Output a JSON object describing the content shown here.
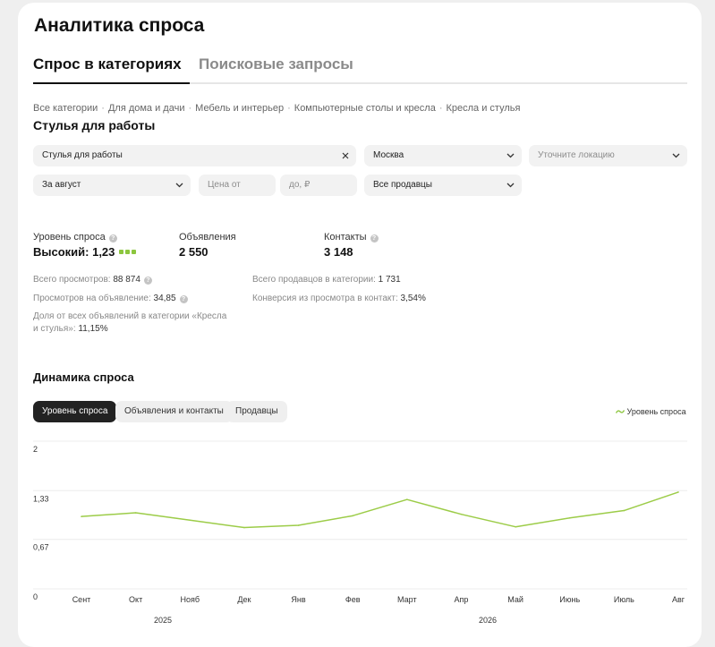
{
  "page_title": "Аналитика спроса",
  "tabs": [
    {
      "label": "Спрос в категориях",
      "active": true
    },
    {
      "label": "Поисковые запросы",
      "active": false
    }
  ],
  "breadcrumb": [
    "Все категории",
    "Для дома и дачи",
    "Мебель и интерьер",
    "Компьютерные столы и кресла",
    "Кресла и стулья"
  ],
  "category_title": "Стулья для работы",
  "filters": {
    "category_value": "Стулья для работы",
    "city_value": "Москва",
    "location_placeholder": "Уточните локацию",
    "period_value": "За август",
    "price_from_placeholder": "Цена от",
    "price_to_placeholder": "до, ₽",
    "sellers_value": "Все продавцы"
  },
  "metrics": {
    "demand_label": "Уровень спроса",
    "demand_value": "Высокий: 1,23",
    "ads_label": "Объявления",
    "ads_value": "2 550",
    "contacts_label": "Контакты",
    "contacts_value": "3 148"
  },
  "stats": {
    "views_label": "Всего просмотров:",
    "views_value": "88 874",
    "views_per_ad_label": "Просмотров на объявление:",
    "views_per_ad_value": "34,85",
    "share_label_line1": "Доля от всех объявлений в категории «Кресла",
    "share_label_line2": "и стулья»:",
    "share_value": "11,15%",
    "sellers_label": "Всего продавцов в категории:",
    "sellers_value": "1 731",
    "conversion_label": "Конверсия из просмотра в контакт:",
    "conversion_value": "3,54%"
  },
  "dynamics": {
    "title": "Динамика спроса",
    "chips": [
      {
        "label": "Уровень спроса",
        "active": true
      },
      {
        "label": "Объявления и контакты",
        "active": false
      },
      {
        "label": "Продавцы",
        "active": false
      }
    ],
    "legend_label": "Уровень спроса"
  },
  "colors": {
    "accent_green": "#8cc63e",
    "line_green": "#9ccc48",
    "active_chip": "#222222"
  },
  "icons": [
    "chevron-down-icon",
    "close-icon",
    "help-icon",
    "legend-line-icon"
  ],
  "chart_data": {
    "type": "line",
    "categories": [
      "Сент",
      "Окт",
      "Нояб",
      "Дек",
      "Янв",
      "Фев",
      "Март",
      "Апр",
      "Май",
      "Июнь",
      "Июль",
      "Авг"
    ],
    "year_labels": [
      "2025",
      "2026"
    ],
    "series": [
      {
        "name": "Уровень спроса",
        "values": [
          0.98,
          1.03,
          0.93,
          0.83,
          0.86,
          0.99,
          1.21,
          1.01,
          0.84,
          0.96,
          1.06,
          1.31
        ]
      }
    ],
    "y_ticks": [
      "2",
      "1,33",
      "0,67",
      "0"
    ],
    "ylim": [
      0,
      2
    ],
    "grid": true,
    "legend": "top-right"
  }
}
